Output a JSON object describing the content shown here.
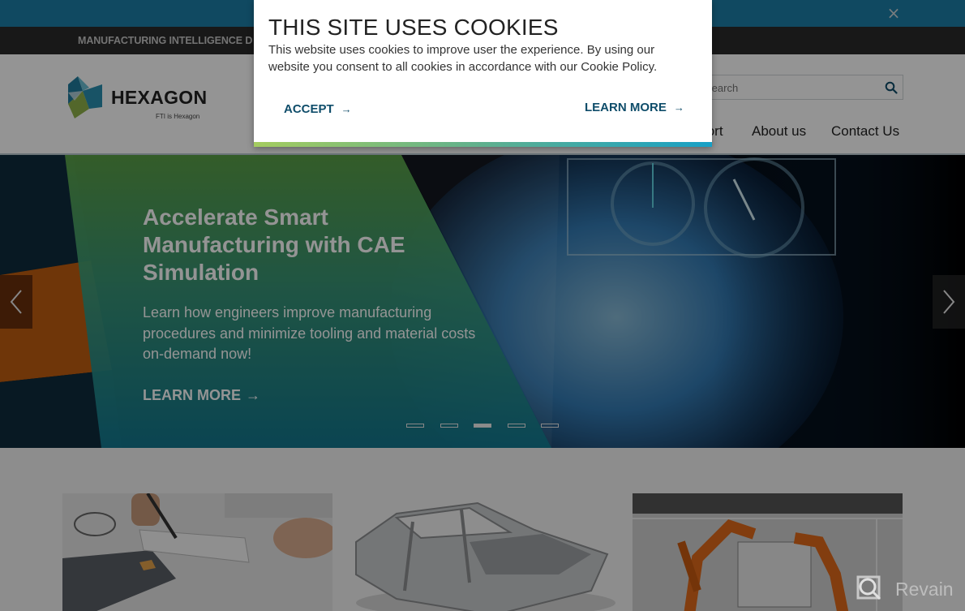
{
  "top_banner": {
    "close_label": "×",
    "close_icon": "close-icon"
  },
  "utility_bar": {
    "text": "MANUFACTURING INTELLIGENCE D"
  },
  "header": {
    "logo": {
      "name": "HEXAGON",
      "tagline": "FTI is Hexagon"
    },
    "search": {
      "placeholder": "Search",
      "icon": "search-icon"
    },
    "nav": [
      {
        "label": "Support"
      },
      {
        "label": "About us"
      },
      {
        "label": "Contact Us"
      }
    ]
  },
  "hero": {
    "title": "Accelerate Smart Manufacturing with CAE Simulation",
    "description": "Learn how engineers improve manufacturing procedures and minimize tooling and material costs on-demand now!",
    "cta_label": "LEARN MORE",
    "cta_arrow": "→",
    "prev_icon": "chevron-left-icon",
    "next_icon": "chevron-right-icon",
    "slides_total": 5,
    "active_slide": 3
  },
  "cards": [
    {
      "image": "accounting-calculator-photo"
    },
    {
      "image": "car-body-frame-photo"
    },
    {
      "image": "robot-assembly-line-photo"
    }
  ],
  "cookie_modal": {
    "title": "THIS SITE USES COOKIES",
    "text": "This website uses cookies to improve user the experience. By using our website you consent to all cookies in accordance with our Cookie Policy.",
    "accept_label": "ACCEPT",
    "learn_more_label": "LEARN MORE",
    "arrow": "→",
    "accent_colors": [
      "#a4cc5f",
      "#17a0c6"
    ]
  },
  "watermark": {
    "text": "Revain"
  },
  "colors": {
    "link": "#0f4d6a",
    "topbar": "#1d7fa8",
    "utility_bar": "#2a2a2a"
  }
}
